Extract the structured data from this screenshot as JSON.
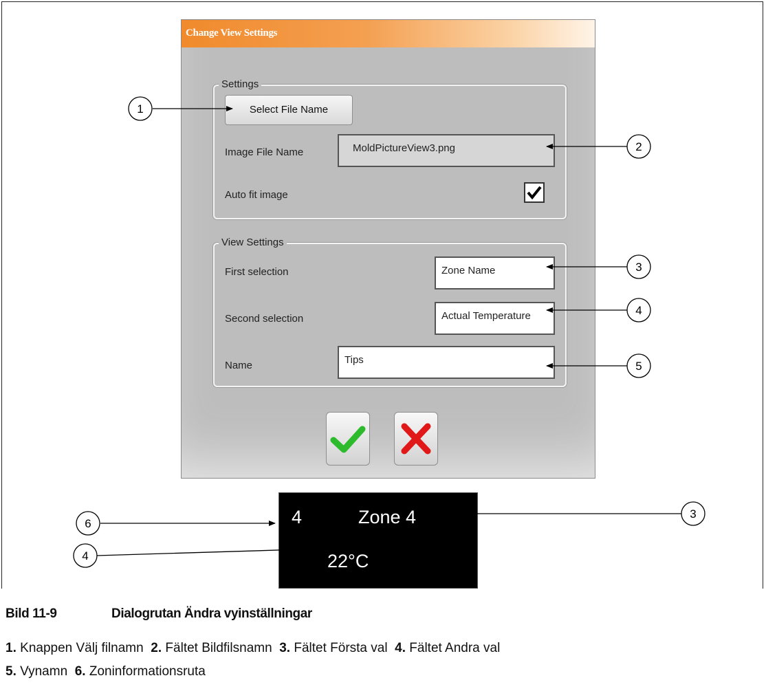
{
  "dialog": {
    "title": "Change View Settings",
    "settings_group": {
      "legend": "Settings",
      "select_file_button": "Select File Name",
      "image_file_label": "Image File Name",
      "image_file_value": "MoldPictureView3.png",
      "auto_fit_label": "Auto fit image",
      "auto_fit_checked": true
    },
    "view_group": {
      "legend": "View Settings",
      "first_label": "First selection",
      "first_value": "Zone Name",
      "second_label": "Second selection",
      "second_value": "Actual Temperature",
      "name_label": "Name",
      "name_value": "Tips"
    },
    "ok_icon": "checkmark-icon",
    "cancel_icon": "cross-icon",
    "ok_color": "#2dbb2d",
    "cancel_color": "#e01818"
  },
  "zone_box": {
    "zone_number": "4",
    "zone_name": "Zone 4",
    "temperature": "22°C"
  },
  "callouts": [
    "1",
    "2",
    "3",
    "4",
    "5",
    "6",
    "3",
    "4"
  ],
  "caption": {
    "figure": "Bild 11-9",
    "title": "Dialogrutan Ändra vyinställningar"
  },
  "legend": [
    {
      "num": "1.",
      "text": "Knappen Välj filnamn"
    },
    {
      "num": "2.",
      "text": "Fältet Bildfilsnamn"
    },
    {
      "num": "3.",
      "text": "Fältet Första val"
    },
    {
      "num": "4.",
      "text": "Fältet Andra val"
    },
    {
      "num": "5.",
      "text": "Vynamn"
    },
    {
      "num": "6.",
      "text": "Zoninformationsruta"
    }
  ]
}
